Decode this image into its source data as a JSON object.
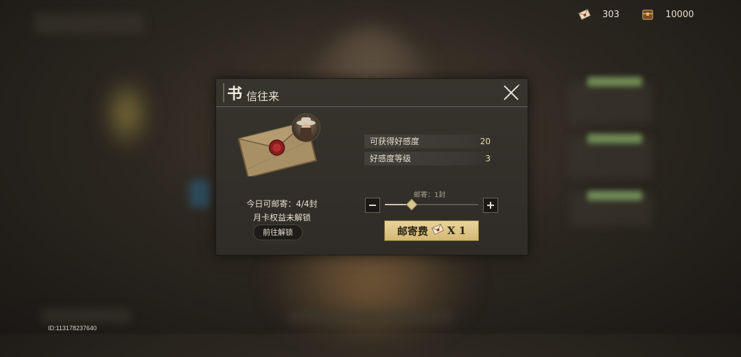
{
  "top_bar": {
    "letter_count": "303",
    "currency_count": "10000",
    "icons": [
      "letter-icon",
      "treasure-chest-icon"
    ]
  },
  "uid": "ID:113178237640",
  "dialog": {
    "title_first_char": "书",
    "title_rest": "信往来",
    "envelope": "sealed-envelope-icon",
    "daily_mail": "今日可邮寄：4/4封",
    "monthly_card": "月卡权益未解锁",
    "goto_unlock": "前往解锁",
    "stats": [
      {
        "label": "可获得好感度",
        "value": "20"
      },
      {
        "label": "好感度等级",
        "value": "3"
      }
    ],
    "send_label": "邮寄：1封",
    "slider_fraction": 0.28,
    "postage_label": "邮寄费",
    "postage_qty": "X 1",
    "colors": {
      "accent": "#d8c792",
      "button": "#e2c98a",
      "panel": "#33302a"
    }
  }
}
